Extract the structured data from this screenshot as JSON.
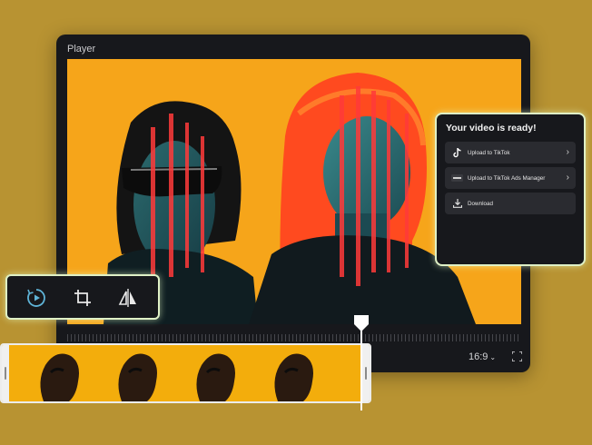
{
  "player": {
    "title": "Player",
    "aspect_ratio": "16:9"
  },
  "export_panel": {
    "title": "Your video is ready!",
    "options": [
      {
        "label": "Upload to TikTok",
        "icon": "tiktok-icon"
      },
      {
        "label": "Upload to TikTok Ads Manager",
        "icon": "tiktok-ads-icon"
      },
      {
        "label": "Download",
        "icon": "download-icon"
      }
    ]
  },
  "tools": [
    {
      "icon": "play-circle-icon",
      "accent": "#5fb4d8"
    },
    {
      "icon": "crop-icon"
    },
    {
      "icon": "flip-icon"
    }
  ],
  "colors": {
    "background": "#b89332",
    "panel": "#17181c",
    "video_bg": "#f6a51a",
    "highlight_border": "#dff0c6"
  }
}
